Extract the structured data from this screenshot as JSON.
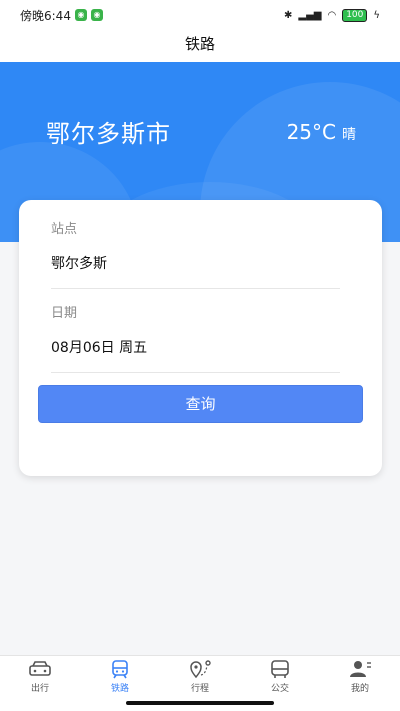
{
  "status": {
    "time": "傍晚6:44",
    "battery": "100"
  },
  "nav": {
    "title": "铁路"
  },
  "hero": {
    "city": "鄂尔多斯市",
    "temperature": "25°C",
    "condition": "晴"
  },
  "form": {
    "station_label": "站点",
    "station_value": "鄂尔多斯",
    "date_label": "日期",
    "date_value": "08月06日  周五",
    "query_label": "查询"
  },
  "tabs": [
    {
      "label": "出行",
      "icon": "car-icon"
    },
    {
      "label": "铁路",
      "icon": "train-icon"
    },
    {
      "label": "行程",
      "icon": "route-icon"
    },
    {
      "label": "公交",
      "icon": "bus-icon"
    },
    {
      "label": "我的",
      "icon": "profile-icon"
    }
  ],
  "colors": {
    "primary": "#2f88f5",
    "button": "#5287f5",
    "active_tab": "#3b82f6"
  }
}
